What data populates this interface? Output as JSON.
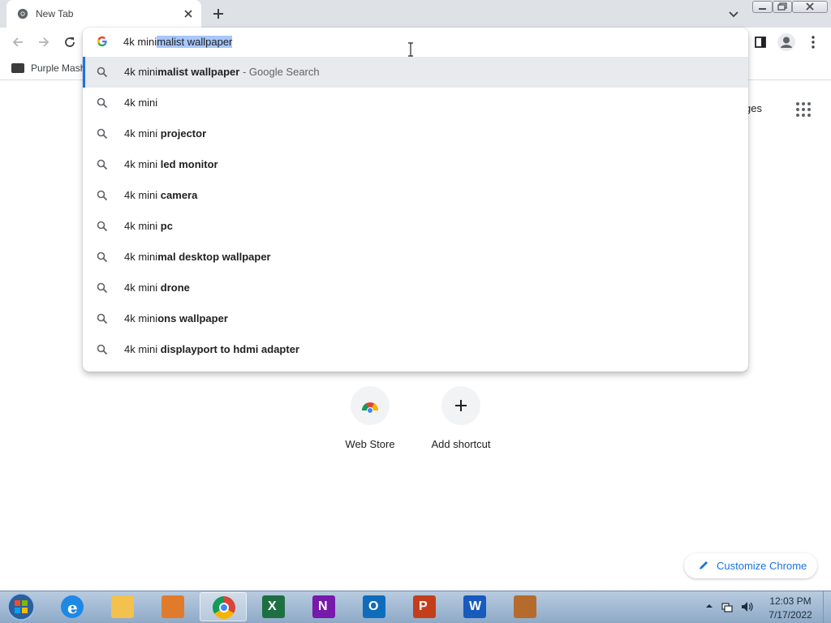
{
  "browser": {
    "tab": {
      "title": "New Tab"
    },
    "bookmarks": [
      {
        "label": "Purple Mash"
      }
    ]
  },
  "omnibox": {
    "typed_text": "4k mini",
    "autocomplete_text": "malist wallpaper",
    "suggestions": [
      {
        "prefix": "4k mini",
        "bold": "malist wallpaper",
        "desc": " - Google Search",
        "active": true
      },
      {
        "prefix": "4k mini",
        "bold": "",
        "desc": ""
      },
      {
        "prefix": "4k mini ",
        "bold": "projector",
        "desc": ""
      },
      {
        "prefix": "4k mini ",
        "bold": "led monitor",
        "desc": ""
      },
      {
        "prefix": "4k mini ",
        "bold": "camera",
        "desc": ""
      },
      {
        "prefix": "4k mini ",
        "bold": "pc",
        "desc": ""
      },
      {
        "prefix": "4k mini",
        "bold": "mal desktop wallpaper",
        "desc": ""
      },
      {
        "prefix": "4k mini ",
        "bold": "drone",
        "desc": ""
      },
      {
        "prefix": "4k mini",
        "bold": "ons wallpaper",
        "desc": ""
      },
      {
        "prefix": "4k mini ",
        "bold": "displayport to hdmi adapter",
        "desc": ""
      }
    ]
  },
  "ntp": {
    "images_link": "mages",
    "shortcuts": [
      {
        "label": "Web Store"
      },
      {
        "label": "Add shortcut"
      }
    ],
    "customize_label": "Customize Chrome"
  },
  "taskbar": {
    "apps": [
      {
        "name": "internet-explorer",
        "color": "#1e88e5"
      },
      {
        "name": "file-explorer",
        "color": "#f2c14e"
      },
      {
        "name": "media-player",
        "color": "#e07b2c"
      },
      {
        "name": "chrome",
        "color": "#db4437",
        "active": true
      },
      {
        "name": "excel",
        "color": "#1d6f42"
      },
      {
        "name": "onenote",
        "color": "#7719aa"
      },
      {
        "name": "outlook",
        "color": "#0f6cbd"
      },
      {
        "name": "powerpoint",
        "color": "#c43e1c"
      },
      {
        "name": "word",
        "color": "#185abd"
      },
      {
        "name": "app",
        "color": "#b56b2b"
      }
    ],
    "clock": {
      "time": "12:03 PM",
      "date": "7/17/2022"
    }
  },
  "colors": {
    "accent": "#1a73e8",
    "tabstrip": "#dee1e6",
    "selection": "#a8c7fa"
  }
}
